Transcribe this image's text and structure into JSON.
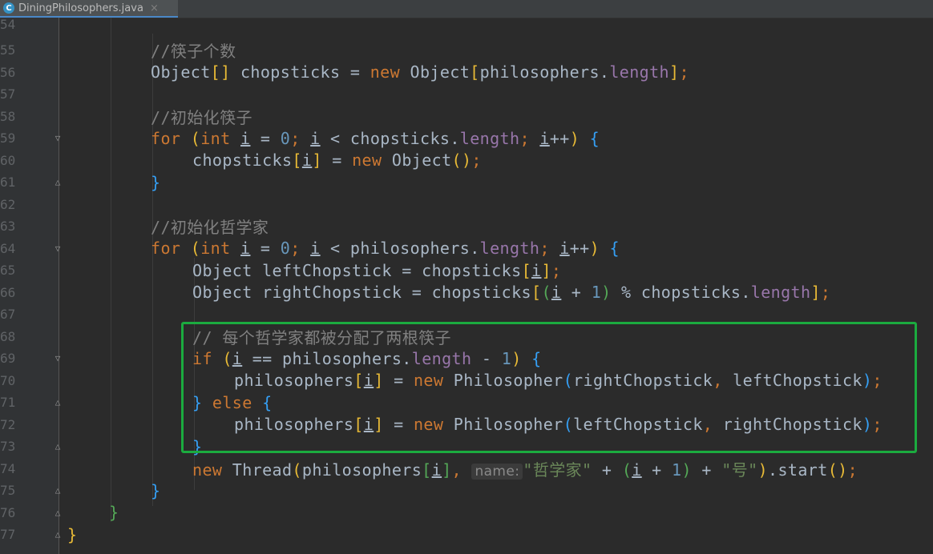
{
  "tab": {
    "icon_letter": "C",
    "filename": "DiningPhilosophers.java",
    "close": "×"
  },
  "lines": [
    {
      "n": "54"
    },
    {
      "n": "55"
    },
    {
      "n": "56"
    },
    {
      "n": "57"
    },
    {
      "n": "58"
    },
    {
      "n": "59"
    },
    {
      "n": "60"
    },
    {
      "n": "61"
    },
    {
      "n": "62"
    },
    {
      "n": "63"
    },
    {
      "n": "64"
    },
    {
      "n": "65"
    },
    {
      "n": "66"
    },
    {
      "n": "67"
    },
    {
      "n": "68"
    },
    {
      "n": "69"
    },
    {
      "n": "70"
    },
    {
      "n": "71"
    },
    {
      "n": "72"
    },
    {
      "n": "73"
    },
    {
      "n": "74"
    },
    {
      "n": "75"
    },
    {
      "n": "76"
    },
    {
      "n": "77"
    }
  ],
  "code": {
    "c55": "//筷子个数",
    "c58": "//初始化筷子",
    "c63": "//初始化哲学家",
    "c68": "// 每个哲学家都被分配了两根筷子",
    "hint_name": "name:",
    "str_phil": "\"哲学家\"",
    "str_hao": "\"号\""
  },
  "colors": {
    "highlight_box": "#1bab3f",
    "keyword": "#cc7832",
    "comment": "#808080",
    "number": "#6897bb",
    "field": "#9876aa",
    "string": "#6a8759"
  }
}
